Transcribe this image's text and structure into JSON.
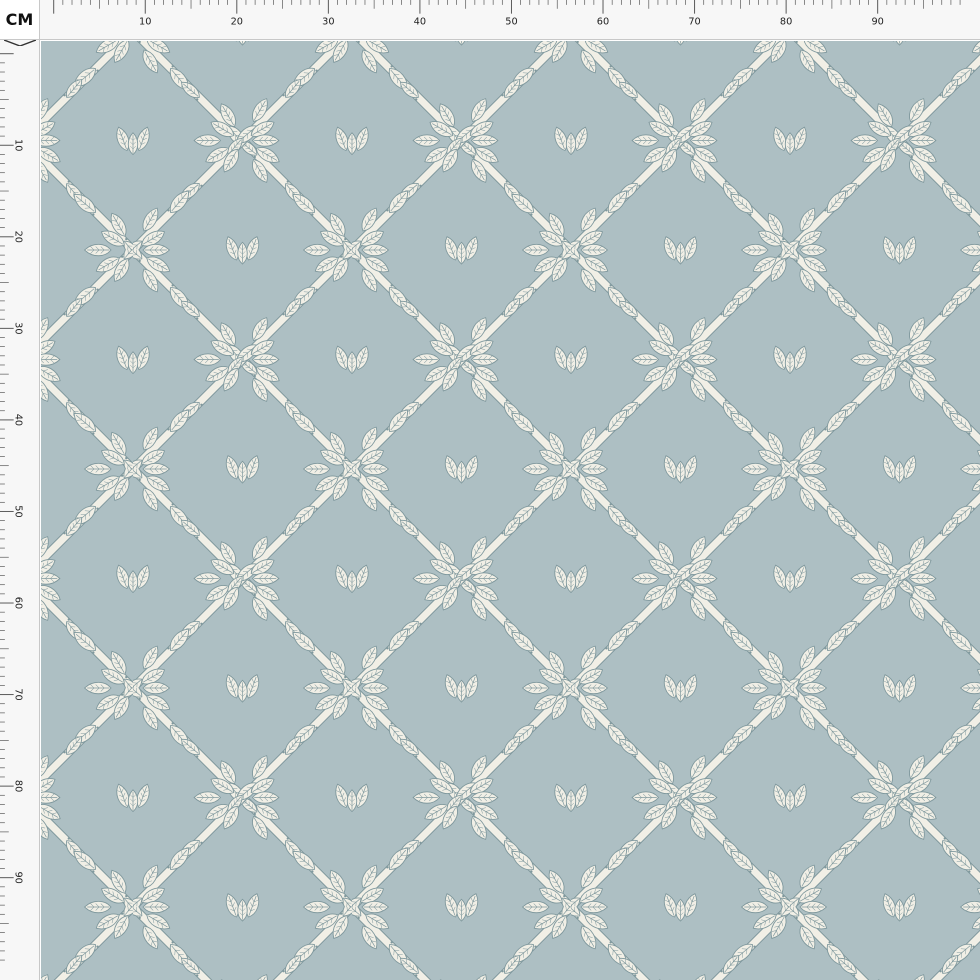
{
  "unit_label": "CM",
  "ruler": {
    "labels": [
      "10",
      "20",
      "30",
      "40",
      "50",
      "60",
      "70",
      "80",
      "90"
    ]
  },
  "pattern": {
    "name": "diagonal leafy branch trellis",
    "background_color": "#adbfc3",
    "branch_color": "#f1efe6",
    "outline_color": "#7f989d"
  },
  "icons": {
    "corner": "v-notch-mark",
    "motif": "leaf-sprig"
  }
}
